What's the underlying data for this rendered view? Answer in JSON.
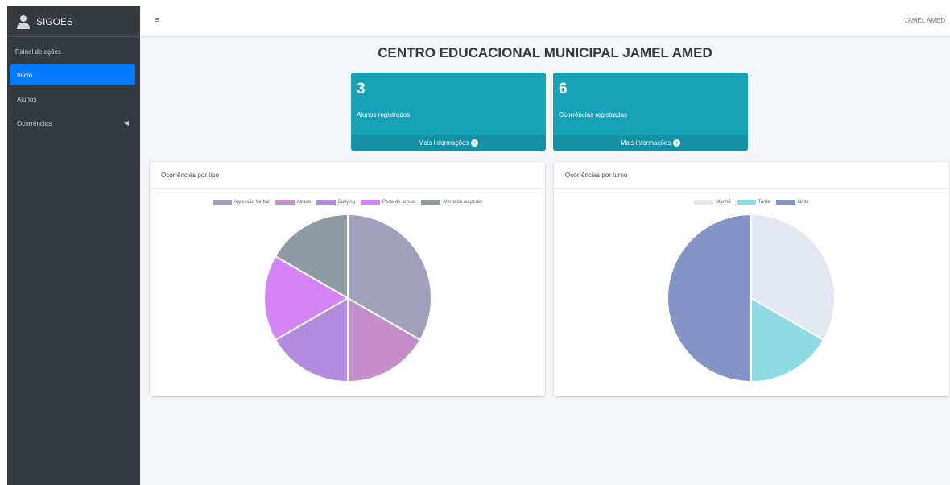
{
  "sidebar": {
    "brand": "SIGOES",
    "header": "Painel de ações",
    "items": [
      {
        "label": "Início"
      },
      {
        "label": "Alunos"
      },
      {
        "label": "Ocorrências"
      }
    ]
  },
  "topbar": {
    "menu_icon": "≡",
    "user": "JAMEL AMED"
  },
  "main": {
    "title": "CENTRO EDUCACIONAL MUNICIPAL JAMEL AMED",
    "boxes": [
      {
        "value": "3",
        "label": "Alunos registrados",
        "footer": "Mais informações"
      },
      {
        "value": "6",
        "label": "Ocorrências registradas",
        "footer": "Mais informações"
      }
    ]
  },
  "chart_data": [
    {
      "type": "pie",
      "title": "Ocorrências por tipo",
      "categories": [
        "Agressão Verbal",
        "Atraso",
        "Bullying",
        "Porte de armas",
        "Atentado ao poder"
      ],
      "values": [
        2,
        1,
        1,
        1,
        1
      ],
      "colors": [
        "#a0a0bd",
        "#c38ec9",
        "#b28ade",
        "#d483f5",
        "#8c9aa3"
      ],
      "legend_position": "top"
    },
    {
      "type": "pie",
      "title": "Ocorrências por turno",
      "categories": [
        "Manhã",
        "Tarde",
        "Noite"
      ],
      "values": [
        2,
        1,
        3
      ],
      "colors": [
        "#e3e7f1",
        "#8fdbe4",
        "#8494c7"
      ],
      "legend_position": "top"
    }
  ]
}
